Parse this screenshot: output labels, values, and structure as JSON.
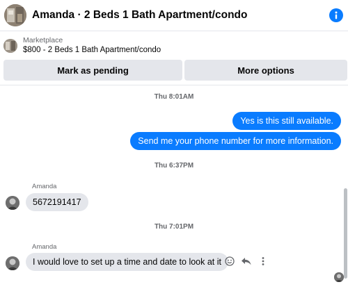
{
  "header": {
    "title": "Amanda · 2 Beds 1 Bath Apartment/condo",
    "avatar_icon": "apartment-photo",
    "info_icon": "info-icon",
    "accent": "#0a7cff"
  },
  "marketplace": {
    "label": "Marketplace",
    "listing": "$800 - 2 Beds 1 Bath Apartment/condo",
    "thumb_icon": "listing-thumbnail"
  },
  "actions": {
    "mark_pending": "Mark as pending",
    "more_options": "More options"
  },
  "conversation": {
    "timestamps": [
      "Thu 8:01AM",
      "Thu 6:37PM",
      "Thu 7:01PM"
    ],
    "outgoing": [
      "Yes is this still available.",
      "Send me your phone number for more information."
    ],
    "incoming": [
      {
        "sender": "Amanda",
        "text": "5672191417"
      },
      {
        "sender": "Amanda",
        "text": "I would love to set up a time and date to look at it"
      }
    ],
    "message_actions": [
      "smiley-react-icon",
      "reply-icon",
      "more-vertical-icon"
    ]
  },
  "colors": {
    "outgoing_bubble": "#0a7cff",
    "incoming_bubble": "#e4e6eb",
    "secondary_text": "#65676b"
  }
}
